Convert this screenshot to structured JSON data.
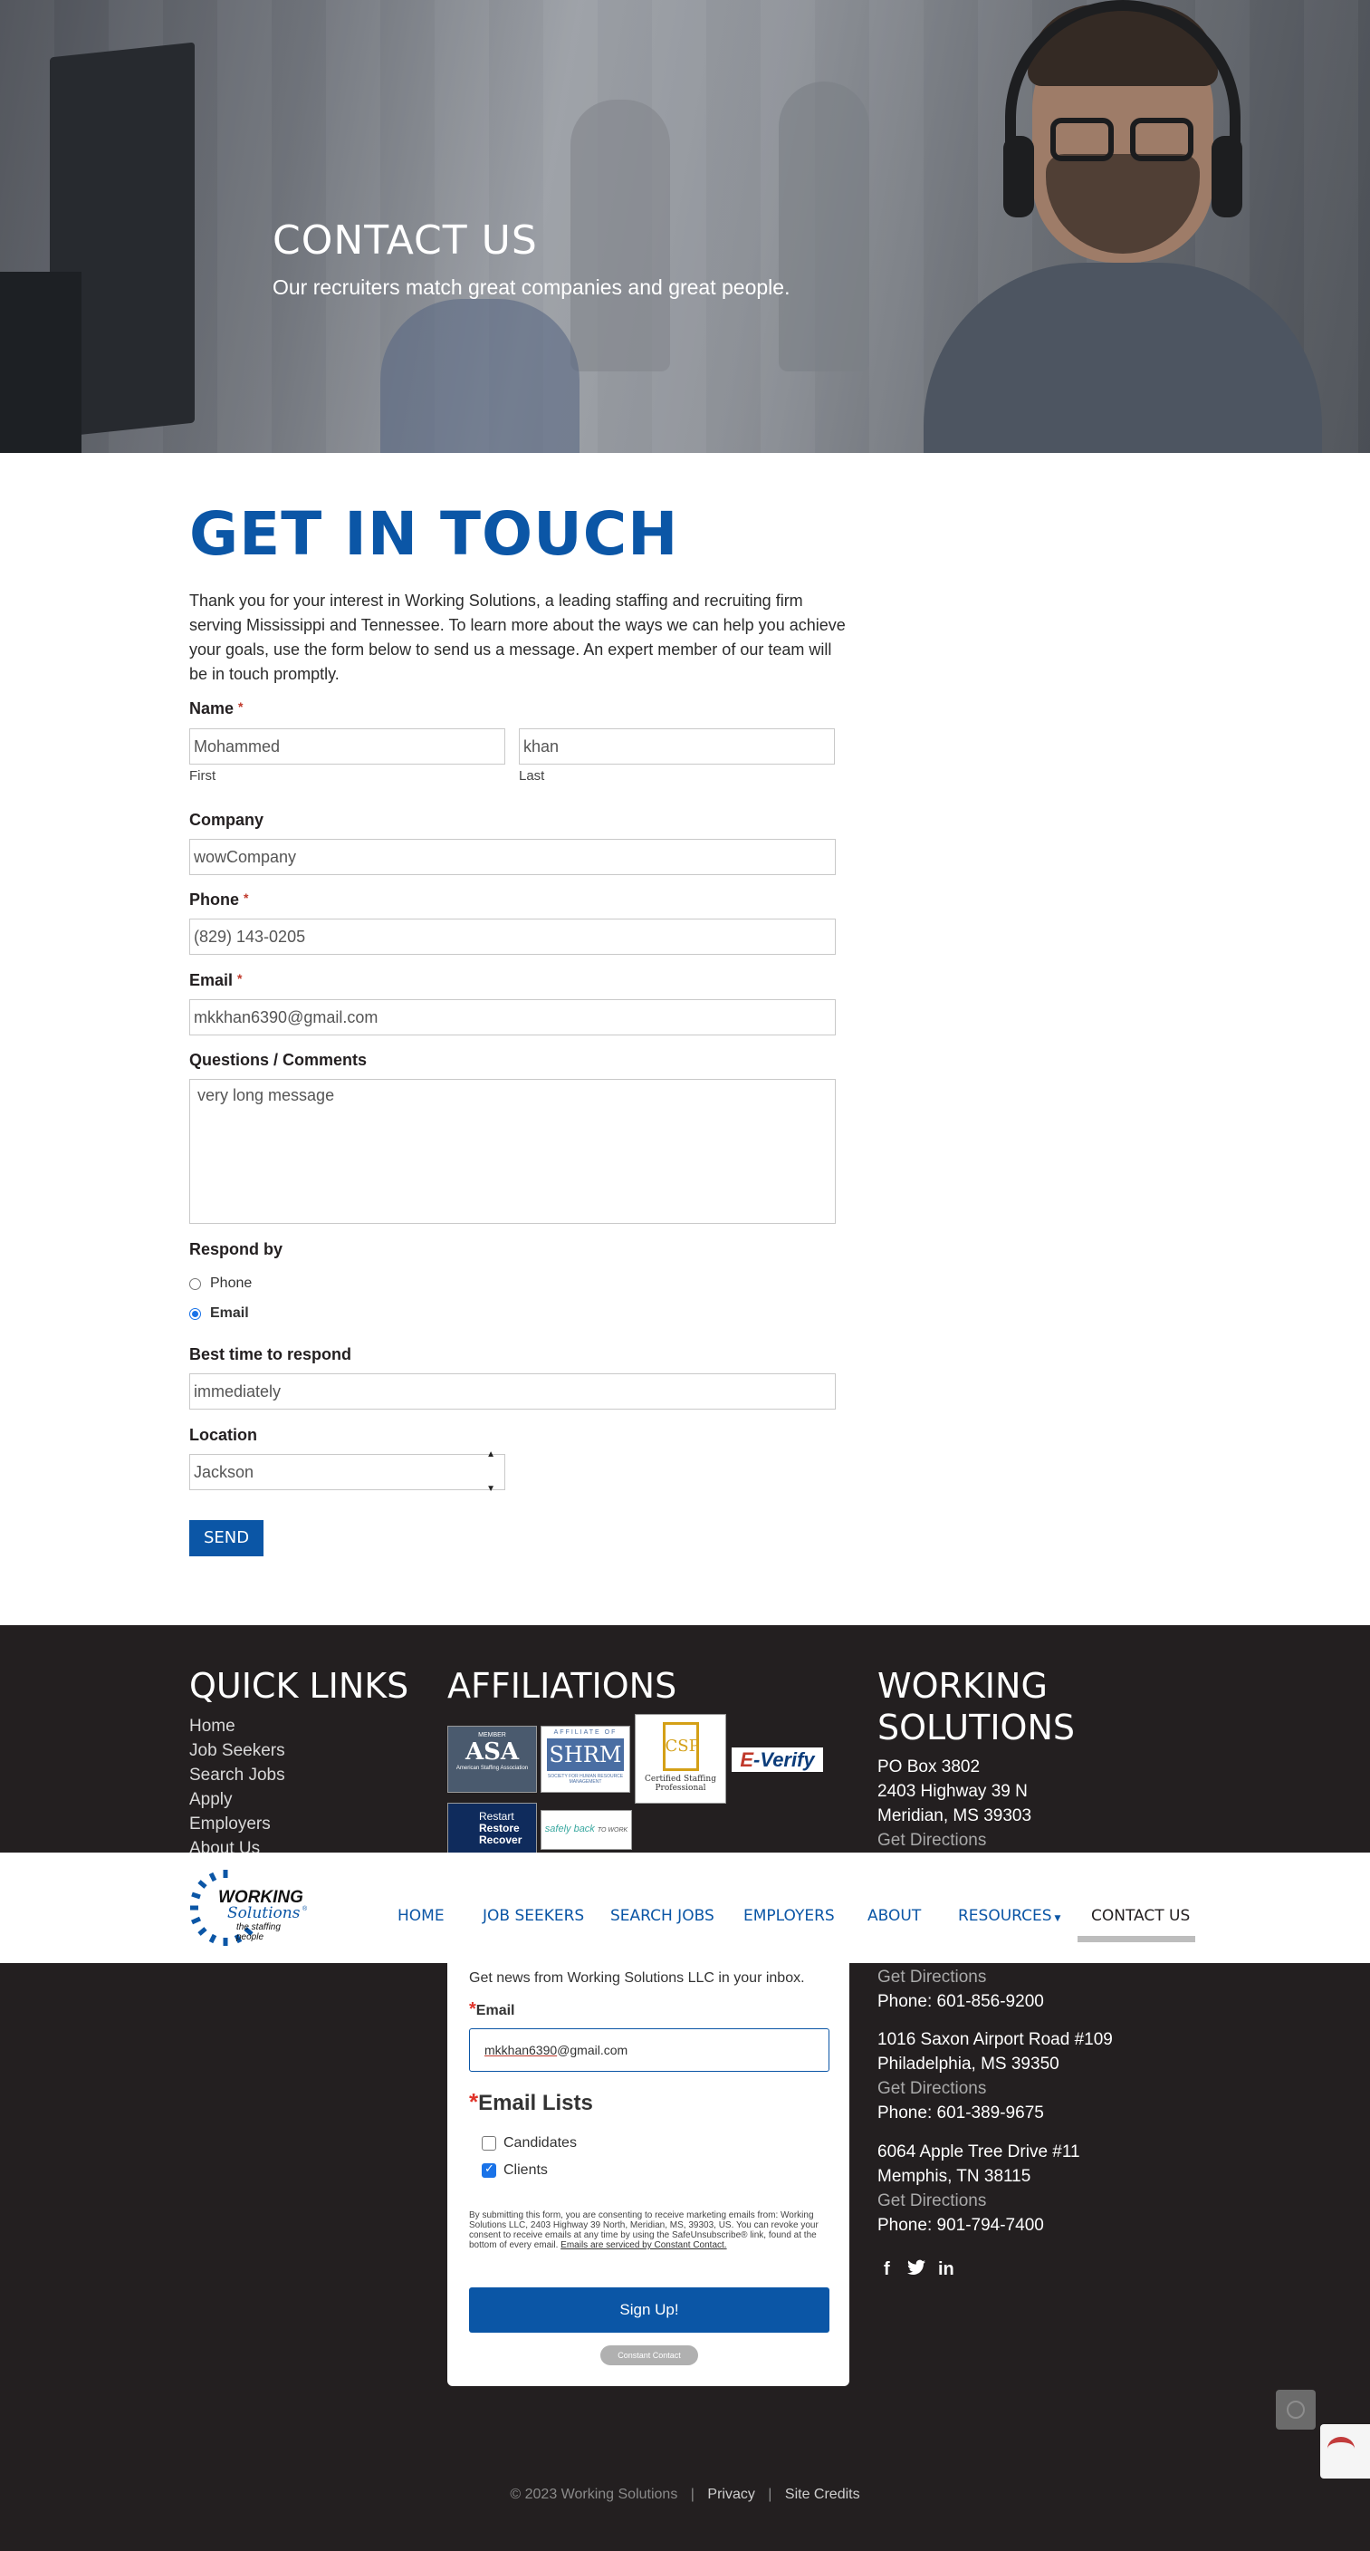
{
  "hero": {
    "title": "CONTACT US",
    "subtitle": "Our recruiters match great companies and great people."
  },
  "main": {
    "heading": "GET IN TOUCH",
    "intro": "Thank you for your interest in Working Solutions, a leading staffing and recruiting firm serving Mississippi and Tennessee. To learn more about the ways we can help you achieve your goals, use the form below to send us a message. An expert member of our team will be in touch promptly."
  },
  "form": {
    "name_label": "Name",
    "required_mark": "*",
    "first_value": "Mohammed",
    "first_sub": "First",
    "last_value": "khan",
    "last_sub": "Last",
    "company_label": "Company",
    "company_value": "wowCompany",
    "phone_label": "Phone",
    "phone_value": "(829) 143-0205",
    "email_label": "Email",
    "email_value": "mkkhan6390@gmail.com",
    "comments_label": "Questions / Comments",
    "comments_value": "very long message",
    "respond_label": "Respond by",
    "respond_options": [
      "Phone",
      "Email"
    ],
    "respond_selected": "Email",
    "best_time_label": "Best time to respond",
    "best_time_value": "immediately",
    "location_label": "Location",
    "location_value": "Jackson",
    "send_label": "SEND"
  },
  "footer": {
    "quick_links_title": "QUICK LINKS",
    "quick_links": [
      "Home",
      "Job Seekers",
      "Search Jobs",
      "Apply",
      "Employers",
      "About Us"
    ],
    "affiliations_title": "AFFILIATIONS",
    "affiliations": [
      "MEMBER ASA American Staffing Association",
      "AFFILIATE OF SHRM SOCIETY FOR HUMAN RESOURCE MANAGEMENT",
      "CSP Certified Staffing Professional",
      "E-Verify",
      "Restart Restore Recover",
      "safely back TO WORK"
    ],
    "company_title_1": "WORKING",
    "company_title_2": "SOLUTIONS",
    "address_top": [
      "PO Box 3802",
      "2403 Highway 39 N",
      "Meridian, MS 39303"
    ],
    "directions_label": "Get Directions",
    "locations": [
      {
        "phone": "Phone: 601-856-9200"
      },
      {
        "line1": "1016 Saxon Airport Road #109",
        "line2": "Philadelphia, MS 39350",
        "phone": "Phone: 601-389-9675"
      },
      {
        "line1": "6064 Apple Tree Drive #11",
        "line2": "Memphis, TN 38115",
        "phone": "Phone: 901-794-7400"
      }
    ],
    "social_icons": [
      "facebook-icon",
      "twitter-icon",
      "linkedin-icon"
    ],
    "copyright": "© 2023 Working Solutions",
    "privacy": "Privacy",
    "site_credits": "Site Credits"
  },
  "nav": {
    "logo_line1": "WORKING",
    "logo_line2": "Solutions",
    "logo_tm": "®",
    "logo_tag": "the staffing people",
    "items": [
      "HOME",
      "JOB SEEKERS",
      "SEARCH JOBS",
      "EMPLOYERS",
      "ABOUT",
      "RESOURCES",
      "CONTACT US"
    ],
    "active": "CONTACT US"
  },
  "signup_card": {
    "intro": "Get news from Working Solutions LLC in your inbox.",
    "email_label": "Email",
    "email_value_underlined": "mkkhan6390",
    "email_value_rest": "@gmail.com",
    "lists_label": "Email Lists",
    "lists": [
      {
        "label": "Candidates",
        "checked": false
      },
      {
        "label": "Clients",
        "checked": true
      }
    ],
    "legal": "By submitting this form, you are consenting to receive marketing emails from: Working Solutions LLC, 2403 Highway 39 North, Meridian, MS, 39303, US. You can revoke your consent to receive emails at any time by using the SafeUnsubscribe® link, found at the bottom of every email.",
    "legal_link": "Emails are serviced by Constant Contact.",
    "button": "Sign Up!",
    "badge": "Constant Contact"
  },
  "colors": {
    "brand_blue": "#0b56a6",
    "footer_bg": "#231f20",
    "required_red": "#c0392b"
  }
}
